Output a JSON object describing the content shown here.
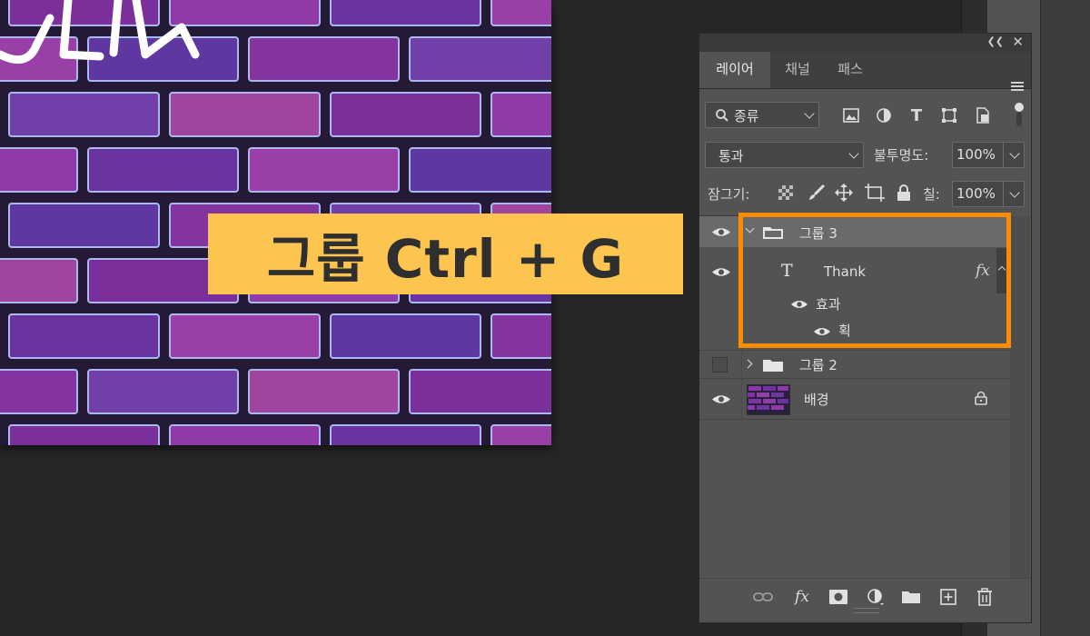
{
  "banner": {
    "text": "그룹 Ctrl + G"
  },
  "panel": {
    "tabs": [
      "레이어",
      "채널",
      "패스"
    ],
    "active_tab": "레이어",
    "filter": {
      "kind_label": "종류"
    },
    "blend_mode": "통과",
    "opacity_label": "불투명도:",
    "opacity_value": "100%",
    "lock_label": "잠그기:",
    "fill_label": "칠:",
    "fill_value": "100%",
    "layers": [
      {
        "name": "그룹 3",
        "type": "group",
        "expanded": true,
        "visible": true
      },
      {
        "name": "Thank",
        "type": "text",
        "visible": true,
        "fx": "fx"
      },
      {
        "name": "효과",
        "type": "effects"
      },
      {
        "name": "획",
        "type": "effect"
      },
      {
        "name": "그룹 2",
        "type": "group",
        "expanded": false,
        "visible": false
      },
      {
        "name": "배경",
        "type": "image",
        "visible": true,
        "locked": true
      }
    ]
  },
  "colors": {
    "highlight": "#ff8c00",
    "banner_bg": "#fec450",
    "panel_bg": "#535353",
    "brick": "#7a2f9a"
  }
}
